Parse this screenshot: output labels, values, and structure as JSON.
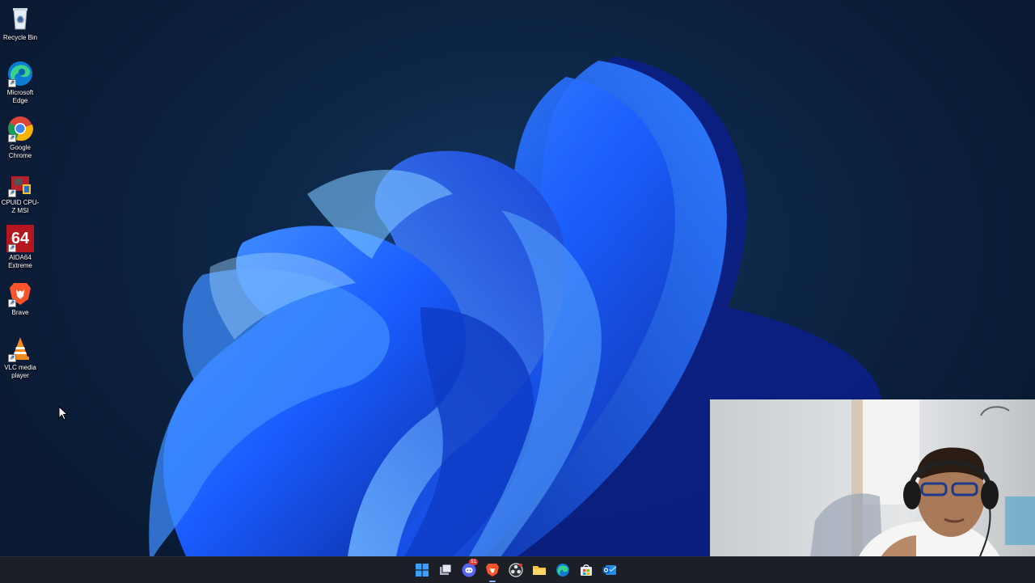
{
  "desktop": {
    "icons": [
      {
        "label": "Recycle Bin",
        "icon": "recycle-bin-icon"
      },
      {
        "label": "Microsoft Edge",
        "icon": "edge-icon"
      },
      {
        "label": "Google Chrome",
        "icon": "chrome-icon"
      },
      {
        "label": "CPUID CPU-Z MSI",
        "icon": "cpuz-icon"
      },
      {
        "label": "AIDA64 Extreme",
        "icon": "aida64-icon"
      },
      {
        "label": "Brave",
        "icon": "brave-icon"
      },
      {
        "label": "VLC media player",
        "icon": "vlc-icon"
      }
    ],
    "aida_glyph": "64"
  },
  "taskbar": {
    "items": [
      {
        "name": "start",
        "icon": "windows-start-icon"
      },
      {
        "name": "task-view",
        "icon": "task-view-icon"
      },
      {
        "name": "discord",
        "icon": "discord-icon",
        "badge": "51"
      },
      {
        "name": "brave",
        "icon": "brave-icon",
        "active": true
      },
      {
        "name": "obs",
        "icon": "obs-icon"
      },
      {
        "name": "file-explorer",
        "icon": "folder-icon"
      },
      {
        "name": "edge",
        "icon": "edge-icon"
      },
      {
        "name": "store",
        "icon": "store-icon"
      },
      {
        "name": "outlook",
        "icon": "mail-icon"
      }
    ]
  },
  "colors": {
    "wallpaper_bloom": "#1a5cff",
    "taskbar_bg": "#1c1f26",
    "brave_orange": "#fb542b"
  }
}
